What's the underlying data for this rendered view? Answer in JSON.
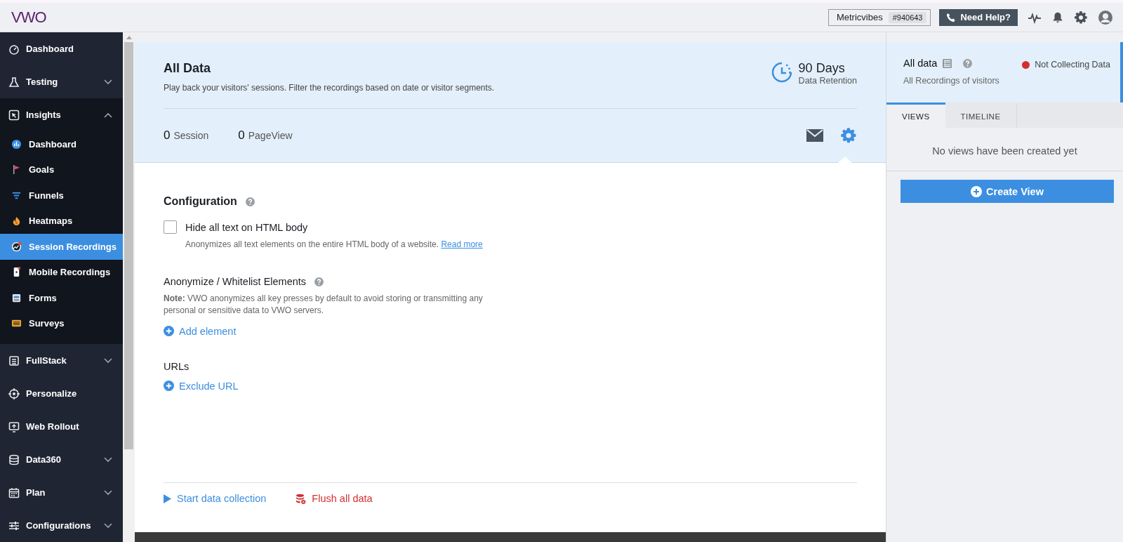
{
  "logo": "VWO",
  "topbar": {
    "account_name": "Metricvibes",
    "account_id": "#940643",
    "help_button": "Need Help?"
  },
  "sidebar": {
    "items": [
      {
        "label": "Dashboard",
        "selected": false
      },
      {
        "label": "Testing",
        "selected": false,
        "expanded": false
      },
      {
        "label": "Insights",
        "selected": false,
        "expanded": true,
        "children": [
          {
            "label": "Dashboard",
            "selected": false
          },
          {
            "label": "Goals",
            "selected": false
          },
          {
            "label": "Funnels",
            "selected": false
          },
          {
            "label": "Heatmaps",
            "selected": false
          },
          {
            "label": "Session Recordings",
            "selected": true
          },
          {
            "label": "Mobile Recordings",
            "selected": false
          },
          {
            "label": "Forms",
            "selected": false
          },
          {
            "label": "Surveys",
            "selected": false
          }
        ]
      },
      {
        "label": "FullStack",
        "selected": false,
        "expanded": false
      },
      {
        "label": "Personalize",
        "selected": false
      },
      {
        "label": "Web Rollout",
        "selected": false
      },
      {
        "label": "Data360",
        "selected": false,
        "expanded": false
      },
      {
        "label": "Plan",
        "selected": false,
        "expanded": false
      },
      {
        "label": "Configurations",
        "selected": false,
        "expanded": false
      }
    ]
  },
  "main": {
    "title": "All Data",
    "description": "Play back your visitors' sessions. Filter the recordings based on date or visitor segments.",
    "retention": {
      "value": "90 Days",
      "label": "Data Retention"
    },
    "stats": [
      {
        "value": "0",
        "label": "Session"
      },
      {
        "value": "0",
        "label": "PageView"
      }
    ],
    "configuration": {
      "title": "Configuration",
      "hide_text": {
        "label": "Hide all text on HTML body",
        "checked": false,
        "description": "Anonymizes all text elements on the entire HTML body of a website.",
        "link": "Read more"
      },
      "anonymize": {
        "title": "Anonymize / Whitelist Elements",
        "note": "**Note:** VWO anonymizes all key presses by default to avoid storing or transmitting any personal or sensitive data to VWO servers.",
        "action": "Add element"
      },
      "urls": {
        "title": "URLs",
        "action": "Exclude URL"
      }
    },
    "footer_actions": [
      {
        "kind": "start",
        "label": "Start data collection"
      },
      {
        "kind": "flush",
        "label": "Flush all data"
      }
    ]
  },
  "panel": {
    "title": "All data",
    "subtitle": "All Recordings of visitors",
    "status": {
      "label": "Not Collecting Data",
      "color": "#d32f2f"
    },
    "tabs": [
      {
        "label": "VIEWS",
        "selected": true
      },
      {
        "label": "TIMELINE",
        "selected": false
      }
    ],
    "empty_message": "No views have been created yet",
    "button": "Create View"
  }
}
